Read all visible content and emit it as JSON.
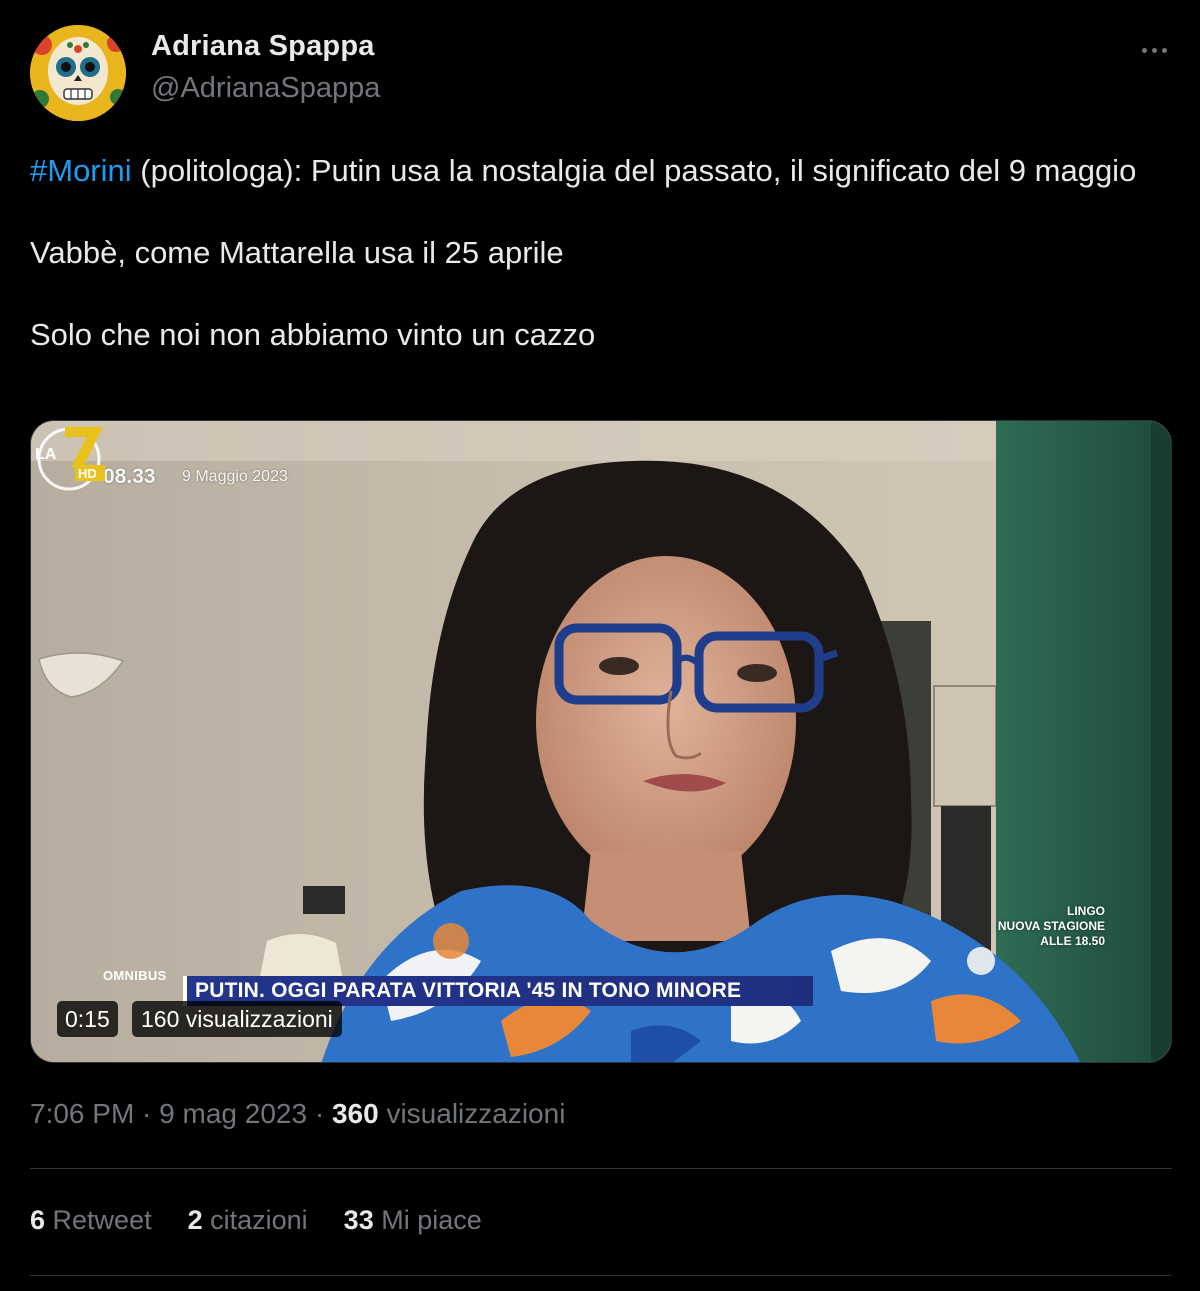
{
  "author": {
    "display_name": "Adriana Spappa",
    "handle": "@AdrianaSpappa",
    "avatar_icon": "sugar-skull-avatar"
  },
  "more_icon": "more-horizontal-icon",
  "tweet": {
    "hashtag": "#Morini",
    "line1_rest": " (politologa): Putin usa la nostalgia del passato, il significato del 9 maggio",
    "line2": "Vabbè, come Mattarella usa il 25 aprile",
    "line3": "Solo che noi non abbiamo vinto un cazzo"
  },
  "video": {
    "osd_time": "08.33",
    "osd_date": "9 Maggio 2023",
    "show_name": "OMNIBUS",
    "headline": "PUTIN. OGGI PARATA VITTORIA '45 IN TONO MINORE",
    "promo_line1": "LINGO",
    "promo_line2": "NUOVA STAGIONE",
    "promo_line3": "ALLE 18.50",
    "channel": "LA 7",
    "channel_suffix": "HD",
    "duration": "0:15",
    "views": "160 visualizzazioni"
  },
  "meta": {
    "time": "7:06 PM",
    "separator": " · ",
    "date": "9 mag 2023",
    "views_count": "360",
    "views_label": " visualizzazioni"
  },
  "stats": {
    "retweets_count": "6",
    "retweets_label": " Retweet",
    "quotes_count": "2",
    "quotes_label": " citazioni",
    "likes_count": "33",
    "likes_label": " Mi piace"
  },
  "colors": {
    "background": "#000000",
    "text": "#e7e9ea",
    "secondary": "#71767b",
    "link": "#1d9bf0",
    "divider": "#2f3336"
  }
}
